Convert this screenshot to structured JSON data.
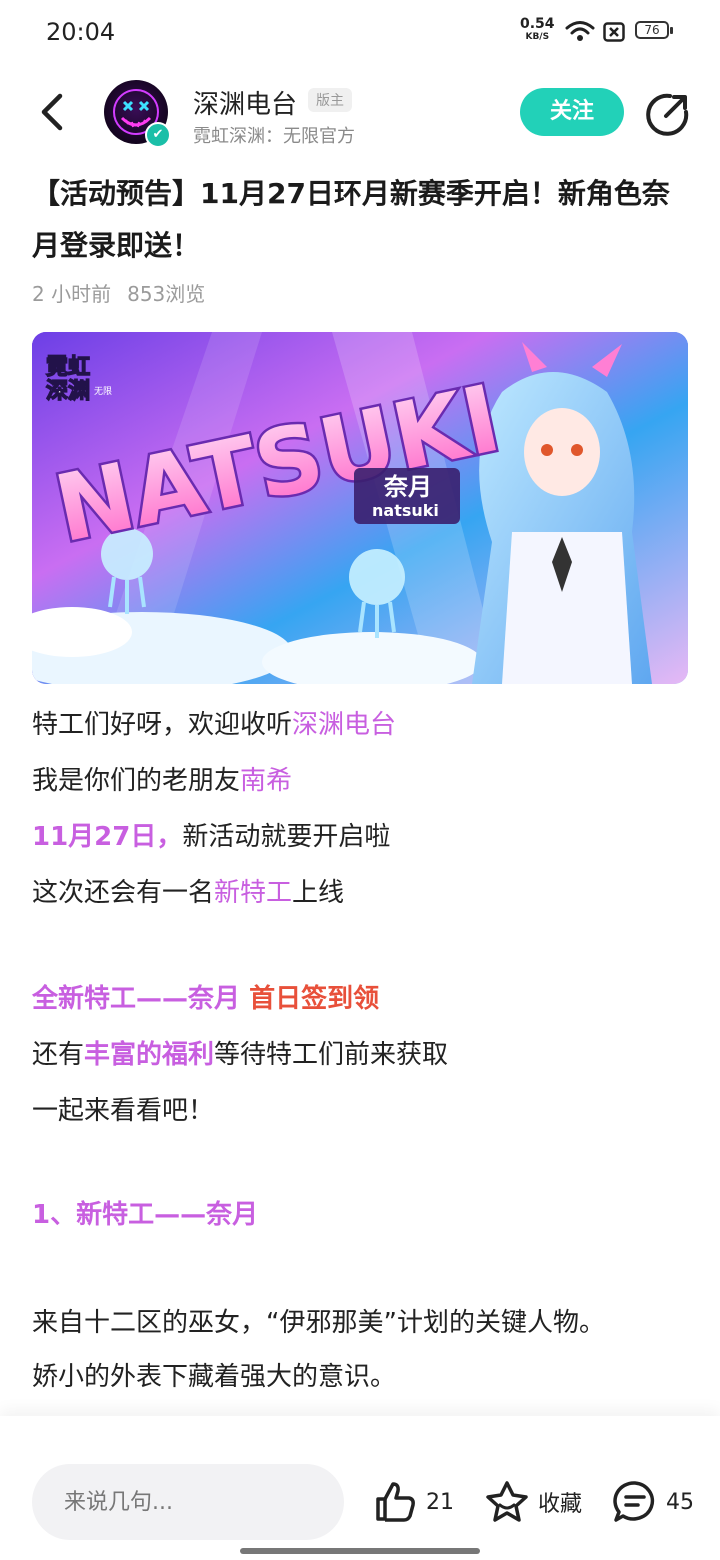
{
  "status_bar": {
    "time": "20:04",
    "net_speed": "0.54",
    "net_unit": "KB/S",
    "battery": "76"
  },
  "header": {
    "author_name": "深渊电台",
    "role_badge": "版主",
    "author_sub": "霓虹深渊：无限官方",
    "follow_label": "关注"
  },
  "post": {
    "title": "【活动预告】11月27日环月新赛季开启！新角色奈月登录即送！",
    "time_ago": "2 小时前",
    "views": "853浏览",
    "banner": {
      "logo_top": "霓虹",
      "logo_bottom": "深渊",
      "logo_side": "无限",
      "big_text": "NATSUKI",
      "cn_name": "奈月",
      "en_name": "natsuki"
    },
    "lines": {
      "l1a": "特工们好呀，欢迎收听",
      "l1b": "深渊电台",
      "l2a": "我是你们的老朋友",
      "l2b": "南希",
      "l3a": "11月27日，",
      "l3b": "新活动就要开启啦",
      "l4a": "这次还会有一名",
      "l4b": "新特工",
      "l4c": "上线",
      "l5a": "全新特工——奈月 ",
      "l5b": "首日签到领",
      "l6a": "还有",
      "l6b": "丰富的福利",
      "l6c": "等待特工们前来获取",
      "l7": "一起来看看吧！",
      "l8": "1、新特工——奈月",
      "l9": "来自十二区的巫女，“伊邪那美”计划的关键人物。",
      "l10": "娇小的外表下藏着强大的意识。"
    }
  },
  "bottom_bar": {
    "comment_placeholder": "来说几句...",
    "like_count": "21",
    "favorite_label": "收藏",
    "comment_count": "45"
  }
}
